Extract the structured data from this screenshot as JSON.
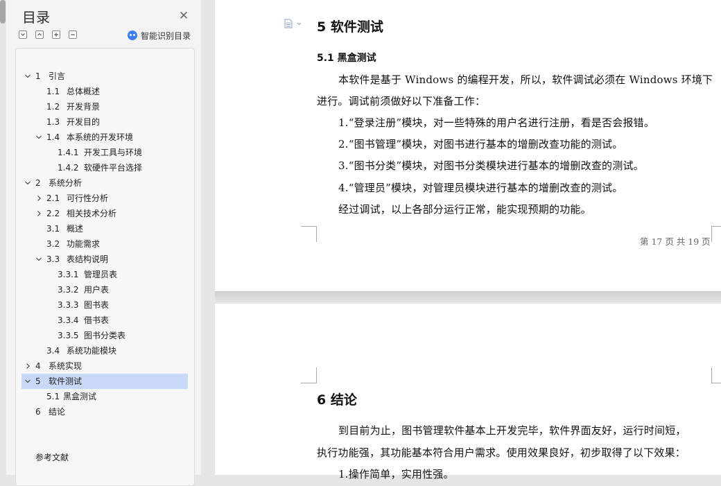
{
  "toc": {
    "title": "目录",
    "close_icon": "close-icon",
    "smart_toc_label": "智能识别目录",
    "items": [
      {
        "num": "1",
        "label": "引言",
        "level": 1,
        "caret": "expanded"
      },
      {
        "num": "1.1",
        "label": "总体概述",
        "level": 2,
        "caret": "none"
      },
      {
        "num": "1.2",
        "label": "开发背景",
        "level": 2,
        "caret": "none"
      },
      {
        "num": "1.3",
        "label": "开发目的",
        "level": 2,
        "caret": "none"
      },
      {
        "num": "1.4",
        "label": "本系统的开发环境",
        "level": 2,
        "caret": "expanded"
      },
      {
        "num": "1.4.1",
        "label": "开发工具与环境",
        "level": 3,
        "caret": "none"
      },
      {
        "num": "1.4.2",
        "label": "软硬件平台选择",
        "level": 3,
        "caret": "none"
      },
      {
        "num": "2",
        "label": "系统分析",
        "level": 1,
        "caret": "expanded"
      },
      {
        "num": "2.1",
        "label": "可行性分析",
        "level": 2,
        "caret": "collapsed"
      },
      {
        "num": "2.2",
        "label": "相关技术分析",
        "level": 2,
        "caret": "collapsed"
      },
      {
        "num": "3.1",
        "label": " 概述",
        "level": 2,
        "caret": "none"
      },
      {
        "num": "3.2",
        "label": "功能需求",
        "level": 2,
        "caret": "none"
      },
      {
        "num": "3.3",
        "label": "表结构说明",
        "level": 2,
        "caret": "expanded"
      },
      {
        "num": "3.3.1",
        "label": "管理员表",
        "level": 3,
        "caret": "none"
      },
      {
        "num": "3.3.2",
        "label": "用户表",
        "level": 3,
        "caret": "none"
      },
      {
        "num": "3.3.3",
        "label": "图书表",
        "level": 3,
        "caret": "none"
      },
      {
        "num": "3.3.4",
        "label": "借书表",
        "level": 3,
        "caret": "none"
      },
      {
        "num": "3.3.5",
        "label": "图书分类表",
        "level": 3,
        "caret": "none"
      },
      {
        "num": "3.4",
        "label": "系统功能模块",
        "level": 2,
        "caret": "none"
      },
      {
        "num": "4",
        "label": "系统实现",
        "level": 1,
        "caret": "collapsed"
      },
      {
        "num": "5",
        "label": "软件测试",
        "level": 1,
        "caret": "expanded",
        "selected": true
      },
      {
        "num": "5.1",
        "label": "黑盒测试",
        "level": 2,
        "caret": "none",
        "tight": true
      },
      {
        "num": "6",
        "label": "结论",
        "level": 1,
        "caret": "none"
      },
      {
        "num": "",
        "label": "参考文献",
        "level": 1,
        "caret": "none",
        "gap": true
      }
    ]
  },
  "document": {
    "page_upper": {
      "heading": "5   软件测试",
      "subheading": "5.1  黑盒测试",
      "lines": [
        "本软件是基于 Windows 的编程开发，所以，软件调试必须在 Windows 环境下",
        "进行。调试前须做好以下准备工作：",
        "1.“登录注册”模块，对一些特殊的用户名进行注册，看是否会报错。",
        "2.“图书管理”模块，对图书进行基本的增删改查功能的测试。",
        "3.“图书分类”模块，对图书分类模块进行基本的增删改查的测试。",
        "4.“管理员”模块，对管理员模块进行基本的增删改查的测试。",
        "经过调试，以上各部分运行正常，能实现预期的功能。"
      ],
      "footer": "第 17 页 共 19 页"
    },
    "page_lower": {
      "heading": "6   结论",
      "lines": [
        "到目前为止，图书管理软件基本上开发完毕，软件界面友好，运行时间短，",
        "执行功能强，其功能基本符合用户需求。使用效果良好，初步取得了以下效果：",
        "1.操作简单，实用性强。"
      ]
    }
  }
}
